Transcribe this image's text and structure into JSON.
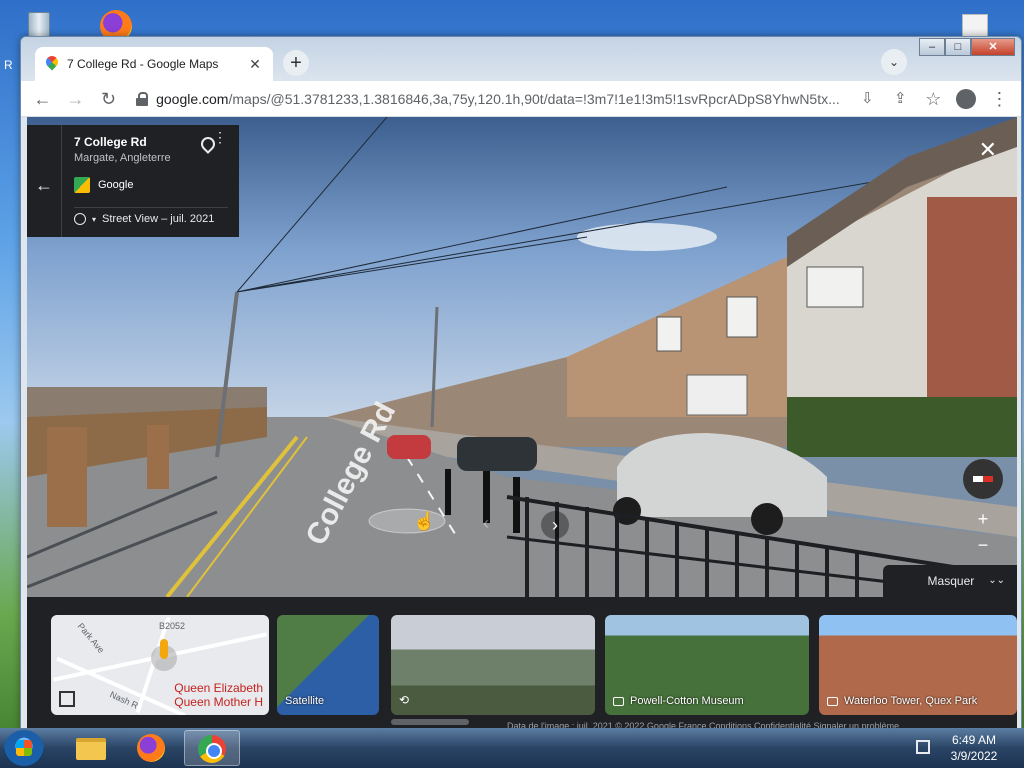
{
  "desktop": {
    "letter": "R",
    "icons": [
      "recycle-bin-icon",
      "firefox-icon",
      "document-icon"
    ]
  },
  "browser": {
    "tab": {
      "title": "7 College Rd - Google Maps",
      "close": "✕"
    },
    "new_tab": "+",
    "tab_search": "⌄",
    "window_buttons": {
      "minimize": "–",
      "maximize": "□",
      "close": "✕"
    },
    "toolbar": {
      "back": "←",
      "forward": "→",
      "reload": "↻",
      "url_host": "google.com",
      "url_rest": "/maps/@51.3781233,1.3816846,3a,75y,120.1h,90t/data=!3m7!1e1!3m5!1svRpcrADpS8YhwN5tx...",
      "install": "⇩",
      "share": "⇪",
      "bookmark": "☆",
      "menu": "⋮"
    }
  },
  "streetview": {
    "place": {
      "title": "7 College Rd",
      "subtitle": "Margate, Angleterre",
      "provider": "Google",
      "date_label": "Street View – juil. 2021"
    },
    "road_text": "College Rd",
    "close": "✕",
    "zoom_in": "+",
    "zoom_out": "−",
    "nav_left": "‹",
    "nav_right": "›",
    "hide_label": "Masquer",
    "hide_chevron": "⌄⌄"
  },
  "filmstrip": {
    "map_thumb": {
      "road_label_1": "B2052",
      "road_label_2": "Park Ave",
      "road_label_3": "Nash R",
      "poi": "Queen Elizabeth Queen Mother H"
    },
    "satellite_label": "Satellite",
    "museum_label": "Powell-Cotton Museum",
    "tower_label": "Waterloo Tower, Quex Park",
    "footer": "Data de l'image : juil. 2021   © 2022 Google   France   Conditions   Confidentialité   Signaler un problème"
  },
  "taskbar": {
    "time": "6:49 AM",
    "date": "3/9/2022"
  },
  "colors": {
    "sky": "#8fb3dd",
    "road": "#8d8e8f",
    "panel": "#202124",
    "taskbar": "#2a4465"
  }
}
